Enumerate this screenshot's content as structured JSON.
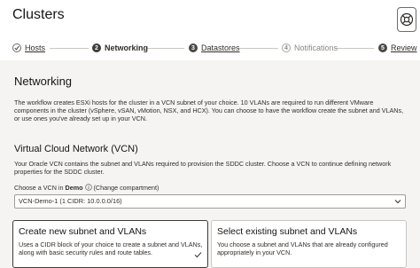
{
  "page": {
    "title": "Clusters"
  },
  "steps": [
    {
      "number": "",
      "label": "Hosts",
      "state": "done"
    },
    {
      "number": "2",
      "label": "Networking",
      "state": "active"
    },
    {
      "number": "3",
      "label": "Datastores",
      "state": "pending"
    },
    {
      "number": "4",
      "label": "Notifications",
      "state": "disabled"
    },
    {
      "number": "5",
      "label": "Review",
      "state": "pending"
    }
  ],
  "networking": {
    "heading": "Networking",
    "description": "The workflow creates ESXi hosts for the cluster in a VCN subnet of your choice. 10 VLANs are required to run different VMware components in the cluster (vSphere, vSAN, vMotion, NSX, and HCX). You can choose to have the workflow create the subnet and VLANs, or use ones you've already set up in your VCN."
  },
  "vcn": {
    "heading": "Virtual Cloud Network (VCN)",
    "description": "Your Oracle VCN contains the subnet and VLANs required to provision the SDDC cluster. Choose a VCN to continue defining network properties for the SDDC cluster.",
    "choose_label": "Choose a VCN in",
    "compartment": "Demo",
    "change_compartment": "(Change compartment)",
    "selected_value": "VCN-Demo-1 (1 CIDR: 10.0.0.0/16)"
  },
  "options": [
    {
      "title": "Create new subnet and VLANs",
      "description": "Uses a CIDR block of your choice to create a subnet and VLANs, along with basic security rules and route tables.",
      "selected": true
    },
    {
      "title": "Select existing subnet and VLANs",
      "description": "You choose a subnet and VLANs that are already configured appropriately in your VCN.",
      "selected": false
    }
  ],
  "icons": {
    "help": "help-icon",
    "check": "check-icon",
    "info": "info-icon",
    "chevron": "chevron-down-icon"
  },
  "colors": {
    "accent": "#3d3a37",
    "background": "#f5f4f2",
    "text": "#312d2a"
  }
}
